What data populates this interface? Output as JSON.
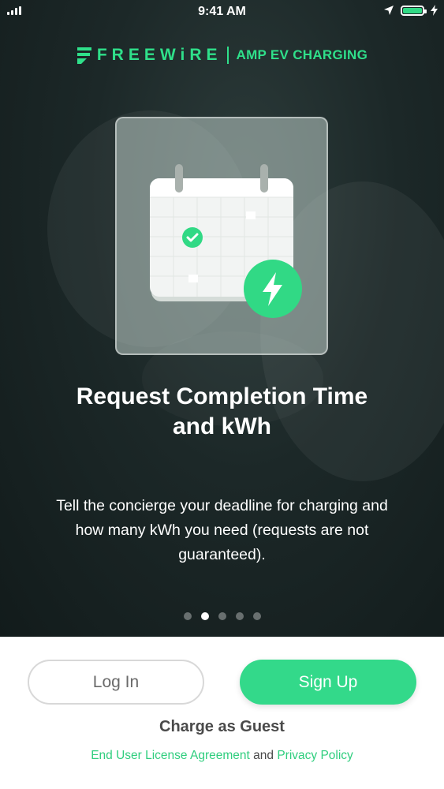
{
  "status_bar": {
    "time": "9:41 AM"
  },
  "brand": {
    "name": "FREEWiRE",
    "product": "AMP EV CHARGING"
  },
  "slide": {
    "title_line1": "Request Completion Time",
    "title_line2": "and kWh",
    "description_line1": "Tell the concierge your deadline for charging and",
    "description_line2": "how many kWh you need (requests are not",
    "description_line3": "guaranteed)."
  },
  "pagination": {
    "total": 5,
    "active_index": 2
  },
  "actions": {
    "login_label": "Log In",
    "signup_label": "Sign Up",
    "guest_label": "Charge as Guest"
  },
  "legal": {
    "eula_label": "End User License Agreement",
    "connector": "and",
    "privacy_label": "Privacy Policy"
  },
  "colors": {
    "accent": "#33d98a",
    "background": "#1c2828"
  },
  "icons": [
    "signal-icon",
    "location-arrow-icon",
    "battery-icon",
    "charging-bolt-icon",
    "calendar-icon",
    "checkmark-icon",
    "lightning-bolt-icon"
  ]
}
